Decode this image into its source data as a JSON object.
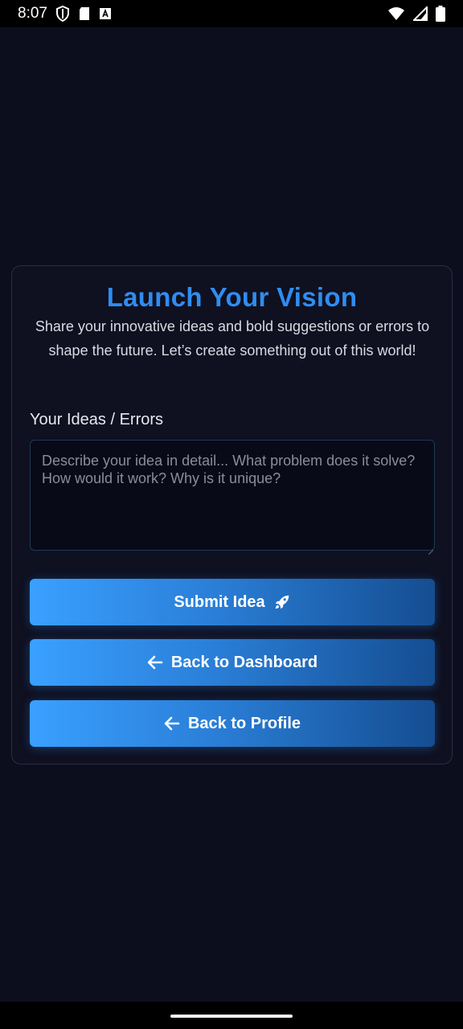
{
  "status_bar": {
    "time": "8:07",
    "left_icons": [
      "shield-icon",
      "sd-card-icon",
      "font-a-icon"
    ],
    "right_icons": [
      "wifi-icon",
      "cellular-icon",
      "battery-icon"
    ]
  },
  "card": {
    "title": "Launch Your Vision",
    "description": "Share your innovative ideas and bold suggestions or errors to shape the future. Let’s create something out of this world!",
    "field_label": "Your Ideas / Errors",
    "textarea": {
      "value": "",
      "placeholder": "Describe your idea in detail... What problem does it solve? How would it work? Why is it unique?"
    },
    "buttons": {
      "submit_label": "Submit Idea",
      "dashboard_label": "Back to Dashboard",
      "profile_label": "Back to Profile"
    }
  },
  "colors": {
    "background": "#0d0e1d",
    "title": "#2f8df0",
    "button_gradient_start": "#3aa0ff",
    "button_gradient_end": "#154d91"
  }
}
